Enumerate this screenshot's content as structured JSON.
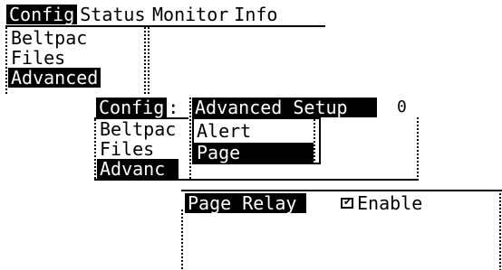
{
  "screen1": {
    "tabs": [
      {
        "label": "Config",
        "active": true
      },
      {
        "label": "Status",
        "active": false
      },
      {
        "label": "Monitor",
        "active": false
      },
      {
        "label": "Info",
        "active": false
      }
    ],
    "menu": [
      {
        "label": "Beltpac",
        "selected": false
      },
      {
        "label": "Files",
        "selected": false
      },
      {
        "label": "Advanced",
        "selected": true
      }
    ]
  },
  "screen2": {
    "tab_label": "Config",
    "tab_sep": ":",
    "corner_value": "0",
    "menu": [
      {
        "label": "Beltpac",
        "selected": false
      },
      {
        "label": "Files",
        "selected": false
      },
      {
        "label": "Advanc",
        "selected": true
      }
    ],
    "popup": {
      "title": "Advanced Setup",
      "items": [
        {
          "label": "Alert",
          "selected": false
        },
        {
          "label": "Page",
          "selected": true
        }
      ]
    }
  },
  "screen3": {
    "title": "Page Relay",
    "checkbox_checked": true,
    "checkbox_label": "Enable"
  }
}
